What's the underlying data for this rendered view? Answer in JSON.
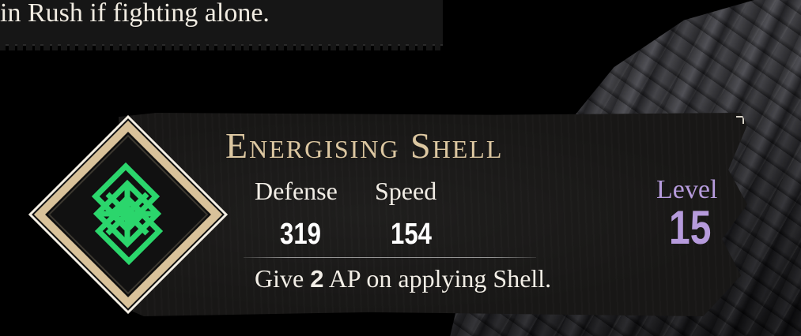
{
  "caption": {
    "text": "in Rush if fighting alone."
  },
  "skill": {
    "name": "Energising Shell",
    "stats": [
      {
        "label": "Defense",
        "value": "319"
      },
      {
        "label": "Speed",
        "value": "154"
      }
    ],
    "description": {
      "before": "Give ",
      "amount": "2",
      "after": " AP on applying Shell."
    },
    "level_label": "Level",
    "level_value": "15",
    "icon": "green-shell-rune-icon"
  },
  "colors": {
    "title": "#dcc7a1",
    "level": "#b69bdc",
    "rune": "#2bd66c",
    "frame": "#e0cba6"
  }
}
